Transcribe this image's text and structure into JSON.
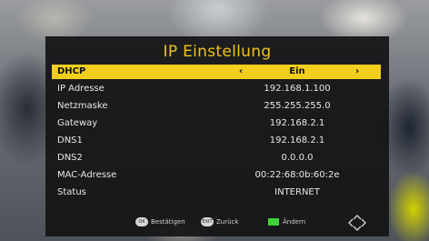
{
  "menu": {
    "title": "IP Einstellung",
    "rows": [
      {
        "label": "DHCP",
        "value": "Ein",
        "selected": true
      },
      {
        "label": "IP Adresse",
        "value": "192.168.1.100"
      },
      {
        "label": "Netzmaske",
        "value": "255.255.255.0"
      },
      {
        "label": "Gateway",
        "value": "192.168.2.1"
      },
      {
        "label": "DNS1",
        "value": "192.168.2.1"
      },
      {
        "label": "DNS2",
        "value": "0.0.0.0"
      },
      {
        "label": "MAC-Adresse",
        "value": "00:22:68:0b:60:2e"
      },
      {
        "label": "Status",
        "value": "INTERNET"
      }
    ],
    "arrow_left": "‹",
    "arrow_right": "›"
  },
  "footer": {
    "ok_key": "OK",
    "confirm_label": "Bestätigen",
    "exit_key": "EXIT",
    "back_label": "Zurück",
    "change_label": "Ändern"
  },
  "colors": {
    "accent": "#f2cf1c",
    "green_key": "#3fd23a"
  }
}
